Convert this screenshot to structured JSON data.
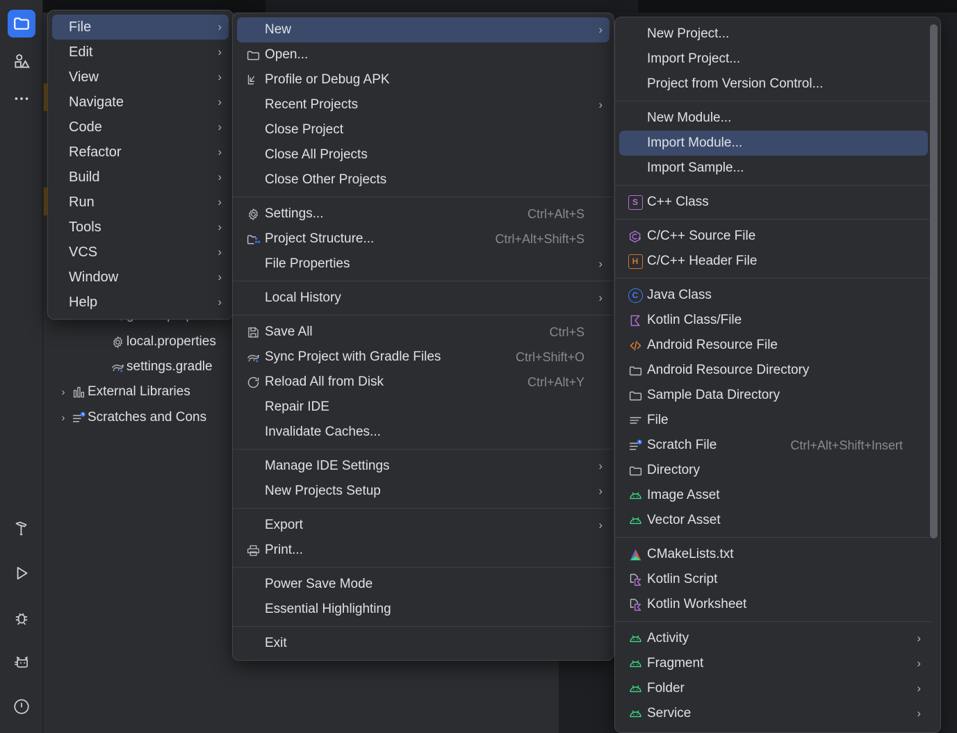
{
  "app": {
    "theme": "Android Studio Dark",
    "accent_blue": "#3574f0",
    "menu_bg": "#2b2d30",
    "selection_bg": "#3b4a6b",
    "text": "#dfe1e5",
    "shortcut_text": "#868a91"
  },
  "activity_bar": {
    "items": [
      {
        "name": "project-folder-icon",
        "label": "Project",
        "active": true
      },
      {
        "name": "resource-manager-icon",
        "label": "Resource Manager",
        "active": false
      },
      {
        "name": "more-tool-windows-icon",
        "label": "More Tool Windows",
        "active": false
      }
    ],
    "bottom_items": [
      {
        "name": "build-hammer-icon",
        "label": "Build"
      },
      {
        "name": "run-play-icon",
        "label": "Run"
      },
      {
        "name": "debug-bug-icon",
        "label": "Debug"
      },
      {
        "name": "logcat-cat-icon",
        "label": "Logcat"
      },
      {
        "name": "problems-warning-icon",
        "label": "Problems"
      }
    ]
  },
  "project_tree": {
    "rows": [
      {
        "label": "gradle.properties",
        "icon": "gradle-icon",
        "arrow": ""
      },
      {
        "label": "local.properties",
        "icon": "properties-gear-icon",
        "arrow": ""
      },
      {
        "label": "settings.gradle",
        "icon": "gradle-icon",
        "arrow": ""
      },
      {
        "label": "External Libraries",
        "icon": "library-icon",
        "arrow": "›"
      },
      {
        "label": "Scratches and Cons",
        "icon": "scratch-icon",
        "arrow": "›"
      }
    ]
  },
  "main_menu": {
    "name": "main-menu-popup",
    "items": [
      {
        "label": "File",
        "submenu": true,
        "selected": true
      },
      {
        "label": "Edit",
        "submenu": true,
        "selected": false
      },
      {
        "label": "View",
        "submenu": true,
        "selected": false
      },
      {
        "label": "Navigate",
        "submenu": true,
        "selected": false
      },
      {
        "label": "Code",
        "submenu": true,
        "selected": false
      },
      {
        "label": "Refactor",
        "submenu": true,
        "selected": false
      },
      {
        "label": "Build",
        "submenu": true,
        "selected": false
      },
      {
        "label": "Run",
        "submenu": true,
        "selected": false
      },
      {
        "label": "Tools",
        "submenu": true,
        "selected": false
      },
      {
        "label": "VCS",
        "submenu": true,
        "selected": false
      },
      {
        "label": "Window",
        "submenu": true,
        "selected": false
      },
      {
        "label": "Help",
        "submenu": true,
        "selected": false
      }
    ]
  },
  "file_menu": {
    "name": "file-menu-popup",
    "groups": [
      {
        "items": [
          {
            "label": "New",
            "icon": "",
            "shortcut": "",
            "submenu": true,
            "selected": true
          },
          {
            "label": "Open...",
            "icon": "folder-icon",
            "shortcut": "",
            "submenu": false,
            "selected": false
          },
          {
            "label": "Profile or Debug APK",
            "icon": "profile-apk-icon",
            "shortcut": "",
            "submenu": false,
            "selected": false
          },
          {
            "label": "Recent Projects",
            "icon": "",
            "shortcut": "",
            "submenu": true,
            "selected": false
          },
          {
            "label": "Close Project",
            "icon": "",
            "shortcut": "",
            "submenu": false,
            "selected": false
          },
          {
            "label": "Close All Projects",
            "icon": "",
            "shortcut": "",
            "submenu": false,
            "selected": false
          },
          {
            "label": "Close Other Projects",
            "icon": "",
            "shortcut": "",
            "submenu": false,
            "selected": false
          }
        ]
      },
      {
        "items": [
          {
            "label": "Settings...",
            "icon": "gear-icon",
            "shortcut": "Ctrl+Alt+S",
            "submenu": false,
            "selected": false
          },
          {
            "label": "Project Structure...",
            "icon": "project-structure-icon",
            "shortcut": "Ctrl+Alt+Shift+S",
            "submenu": false,
            "selected": false
          },
          {
            "label": "File Properties",
            "icon": "",
            "shortcut": "",
            "submenu": true,
            "selected": false
          }
        ]
      },
      {
        "items": [
          {
            "label": "Local History",
            "icon": "",
            "shortcut": "",
            "submenu": true,
            "selected": false
          }
        ]
      },
      {
        "items": [
          {
            "label": "Save All",
            "icon": "save-icon",
            "shortcut": "Ctrl+S",
            "submenu": false,
            "selected": false
          },
          {
            "label": "Sync Project with Gradle Files",
            "icon": "gradle-sync-icon",
            "shortcut": "Ctrl+Shift+O",
            "submenu": false,
            "selected": false
          },
          {
            "label": "Reload All from Disk",
            "icon": "reload-icon",
            "shortcut": "Ctrl+Alt+Y",
            "submenu": false,
            "selected": false
          },
          {
            "label": "Repair IDE",
            "icon": "",
            "shortcut": "",
            "submenu": false,
            "selected": false
          },
          {
            "label": "Invalidate Caches...",
            "icon": "",
            "shortcut": "",
            "submenu": false,
            "selected": false
          }
        ]
      },
      {
        "items": [
          {
            "label": "Manage IDE Settings",
            "icon": "",
            "shortcut": "",
            "submenu": true,
            "selected": false
          },
          {
            "label": "New Projects Setup",
            "icon": "",
            "shortcut": "",
            "submenu": true,
            "selected": false
          }
        ]
      },
      {
        "items": [
          {
            "label": "Export",
            "icon": "",
            "shortcut": "",
            "submenu": true,
            "selected": false
          },
          {
            "label": "Print...",
            "icon": "print-icon",
            "shortcut": "",
            "submenu": false,
            "selected": false
          }
        ]
      },
      {
        "items": [
          {
            "label": "Power Save Mode",
            "icon": "",
            "shortcut": "",
            "submenu": false,
            "selected": false
          },
          {
            "label": "Essential Highlighting",
            "icon": "",
            "shortcut": "",
            "submenu": false,
            "selected": false
          }
        ]
      },
      {
        "items": [
          {
            "label": "Exit",
            "icon": "",
            "shortcut": "",
            "submenu": false,
            "selected": false
          }
        ]
      }
    ]
  },
  "new_menu": {
    "name": "new-submenu-popup",
    "scrollbar_visible": true,
    "groups": [
      {
        "items": [
          {
            "label": "New Project...",
            "icon": "",
            "shortcut": "",
            "submenu": false,
            "selected": false
          },
          {
            "label": "Import Project...",
            "icon": "",
            "shortcut": "",
            "submenu": false,
            "selected": false
          },
          {
            "label": "Project from Version Control...",
            "icon": "",
            "shortcut": "",
            "submenu": false,
            "selected": false
          }
        ]
      },
      {
        "items": [
          {
            "label": "New Module...",
            "icon": "",
            "shortcut": "",
            "submenu": false,
            "selected": false
          },
          {
            "label": "Import Module...",
            "icon": "",
            "shortcut": "",
            "submenu": false,
            "selected": true
          },
          {
            "label": "Import Sample...",
            "icon": "",
            "shortcut": "",
            "submenu": false,
            "selected": false
          }
        ]
      },
      {
        "items": [
          {
            "label": "C++ Class",
            "icon": "cpp-class-icon",
            "shortcut": "",
            "submenu": false,
            "selected": false
          }
        ]
      },
      {
        "items": [
          {
            "label": "C/C++ Source File",
            "icon": "c-source-icon",
            "shortcut": "",
            "submenu": false,
            "selected": false
          },
          {
            "label": "C/C++ Header File",
            "icon": "c-header-icon",
            "shortcut": "",
            "submenu": false,
            "selected": false
          }
        ]
      },
      {
        "items": [
          {
            "label": "Java Class",
            "icon": "java-class-icon",
            "shortcut": "",
            "submenu": false,
            "selected": false
          },
          {
            "label": "Kotlin Class/File",
            "icon": "kotlin-icon",
            "shortcut": "",
            "submenu": false,
            "selected": false
          },
          {
            "label": "Android Resource File",
            "icon": "xml-resource-icon",
            "shortcut": "",
            "submenu": false,
            "selected": false
          },
          {
            "label": "Android Resource Directory",
            "icon": "folder-icon",
            "shortcut": "",
            "submenu": false,
            "selected": false
          },
          {
            "label": "Sample Data Directory",
            "icon": "folder-icon",
            "shortcut": "",
            "submenu": false,
            "selected": false
          },
          {
            "label": "File",
            "icon": "file-lines-icon",
            "shortcut": "",
            "submenu": false,
            "selected": false
          },
          {
            "label": "Scratch File",
            "icon": "scratch-icon",
            "shortcut": "Ctrl+Alt+Shift+Insert",
            "submenu": false,
            "selected": false
          },
          {
            "label": "Directory",
            "icon": "folder-icon",
            "shortcut": "",
            "submenu": false,
            "selected": false
          },
          {
            "label": "Image Asset",
            "icon": "android-icon",
            "shortcut": "",
            "submenu": false,
            "selected": false
          },
          {
            "label": "Vector Asset",
            "icon": "android-icon",
            "shortcut": "",
            "submenu": false,
            "selected": false
          }
        ]
      },
      {
        "items": [
          {
            "label": "CMakeLists.txt",
            "icon": "cmake-icon",
            "shortcut": "",
            "submenu": false,
            "selected": false
          },
          {
            "label": "Kotlin Script",
            "icon": "kotlin-script-icon",
            "shortcut": "",
            "submenu": false,
            "selected": false
          },
          {
            "label": "Kotlin Worksheet",
            "icon": "kotlin-script-icon",
            "shortcut": "",
            "submenu": false,
            "selected": false
          }
        ]
      },
      {
        "items": [
          {
            "label": "Activity",
            "icon": "android-icon",
            "shortcut": "",
            "submenu": true,
            "selected": false
          },
          {
            "label": "Fragment",
            "icon": "android-icon",
            "shortcut": "",
            "submenu": true,
            "selected": false
          },
          {
            "label": "Folder",
            "icon": "android-icon",
            "shortcut": "",
            "submenu": true,
            "selected": false
          },
          {
            "label": "Service",
            "icon": "android-icon",
            "shortcut": "",
            "submenu": true,
            "selected": false
          }
        ]
      }
    ]
  }
}
